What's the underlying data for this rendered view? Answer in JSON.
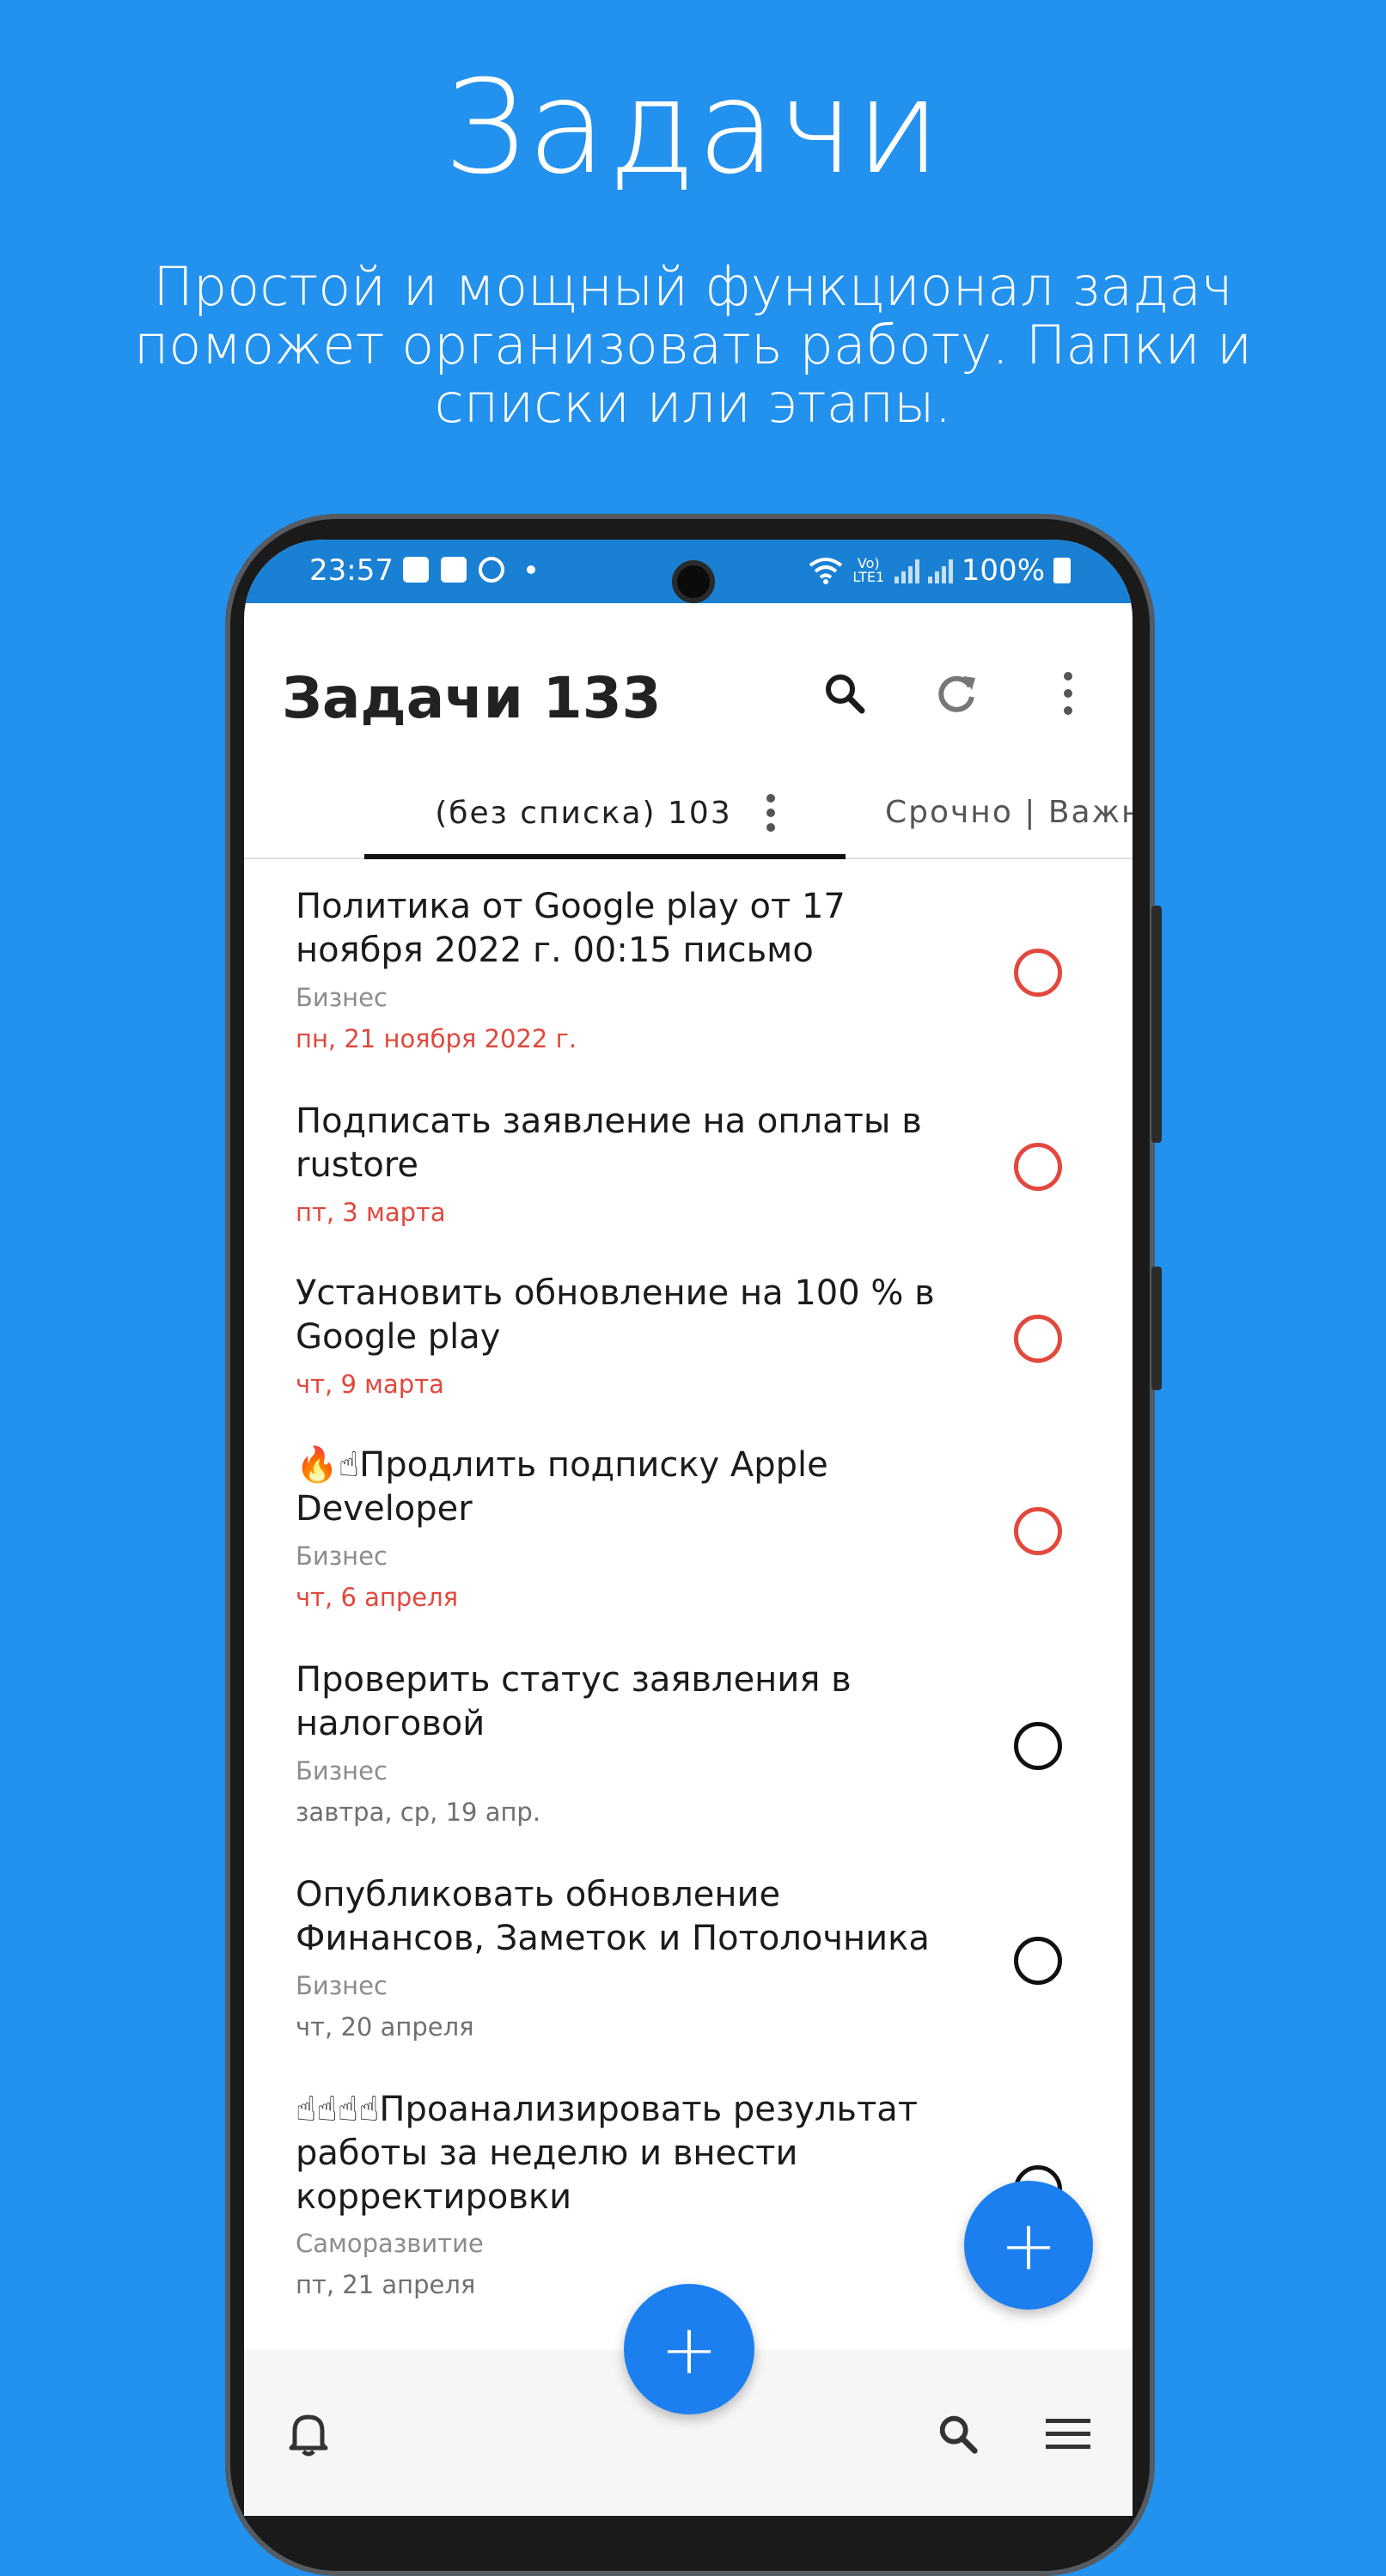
{
  "promo": {
    "title": "Задачи",
    "subtitle": "Простой и мощный функционал задач поможет организовать работу. Папки и списки или этапы."
  },
  "status_bar": {
    "time": "23:57",
    "network_label": "Vo) LTE1",
    "battery": "100%"
  },
  "app_bar": {
    "title": "Задачи 133",
    "actions": [
      "search-icon",
      "refresh-icon",
      "more-vert-icon"
    ]
  },
  "tabs": {
    "active": "(без списка) 103",
    "other": "Срочно | Важн"
  },
  "tasks": [
    {
      "title": "Политика от Google play от 17 ноября 2022 г. 00:15 письмо",
      "category": "Бизнес",
      "date": "пн, 21 ноября 2022 г.",
      "overdue": true
    },
    {
      "title": "Подписать заявление на оплаты в rustore",
      "category": "",
      "date": "пт, 3 марта",
      "overdue": true
    },
    {
      "title": "Установить обновление на 100 % в Google play",
      "category": "",
      "date": "чт, 9 марта",
      "overdue": true
    },
    {
      "title": "🔥☝Продлить подписку Apple Developer",
      "category": "Бизнес",
      "date": "чт, 6 апреля",
      "overdue": true
    },
    {
      "title": "Проверить статус заявления в налоговой",
      "category": "Бизнес",
      "date": "завтра, ср, 19 апр.",
      "overdue": false
    },
    {
      "title": "Опубликовать обновление Финансов, Заметок и Потолочника",
      "category": "Бизнес",
      "date": "чт, 20 апреля",
      "overdue": false
    },
    {
      "title": "☝☝☝☝Проанализировать результат работы за неделю и внести корректировки",
      "category": "Саморазвитие",
      "date": "пт, 21 апреля",
      "overdue": false
    }
  ],
  "fab": {
    "add_label": "+"
  },
  "bottom_bar": {
    "add_label": "+",
    "icons": [
      "bell-icon",
      "search-icon",
      "menu-icon"
    ]
  },
  "colors": {
    "background": "#2391ee",
    "status_bar": "#1a80d3",
    "overdue": "#e2483d",
    "accent": "#1c7ff0"
  }
}
